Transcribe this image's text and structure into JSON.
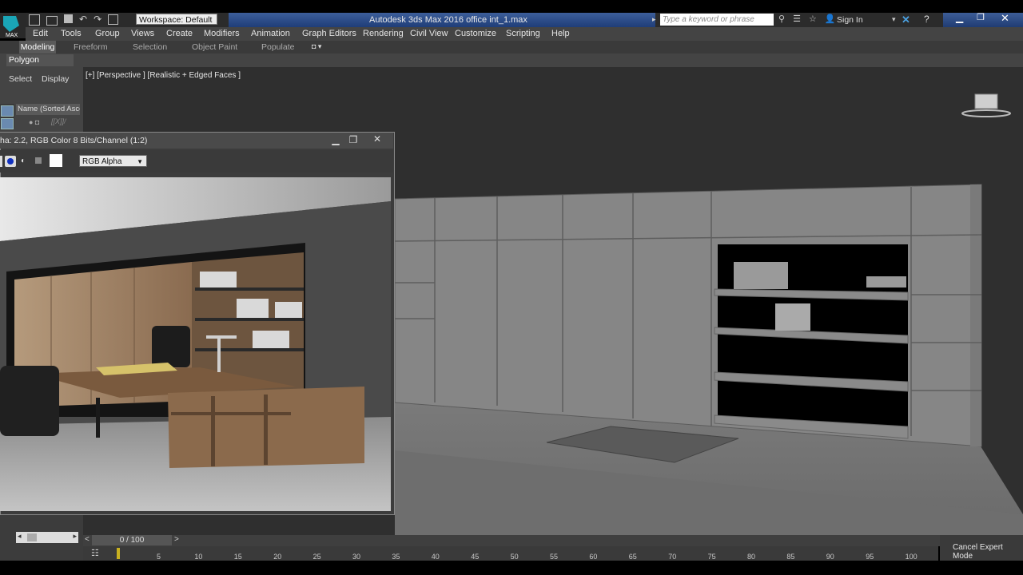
{
  "title": {
    "workspace": "Workspace: Default",
    "app_title": "Autodesk 3ds Max 2016     office int_1.max",
    "search_placeholder": "Type a keyword or phrase",
    "sign_in": "Sign In"
  },
  "menu": [
    "Edit",
    "Tools",
    "Group",
    "Views",
    "Create",
    "Modifiers",
    "Animation",
    "Graph Editors",
    "Rendering",
    "Civil View",
    "Customize",
    "Scripting",
    "Help"
  ],
  "ribbon": {
    "tabs": [
      "Modeling",
      "Freeform",
      "Selection",
      "Object Paint",
      "Populate"
    ],
    "panel_label": "Polygon Modeling"
  },
  "scene_explorer": {
    "tabs": [
      "Select",
      "Display"
    ],
    "column": "Name (Sorted Ascer",
    "item": "[[X]]/"
  },
  "viewport": {
    "label": "[+] [Perspective ] [Realistic + Edged Faces ]"
  },
  "frame_window": {
    "title": "ha: 2.2, RGB Color 8 Bits/Channel (1:2)",
    "channel": "RGB Alpha"
  },
  "timeline": {
    "frame": "0 / 100",
    "ticks": [
      "5",
      "10",
      "15",
      "20",
      "25",
      "30",
      "35",
      "40",
      "45",
      "50",
      "55",
      "60",
      "65",
      "70",
      "75",
      "80",
      "85",
      "90",
      "95",
      "100"
    ]
  },
  "status": {
    "expert": "Cancel Expert Mode"
  },
  "colors": {
    "accent_blue": "#2d4f8c",
    "viewport_bg": "#2f2f2f",
    "panel_bg": "#444444"
  }
}
